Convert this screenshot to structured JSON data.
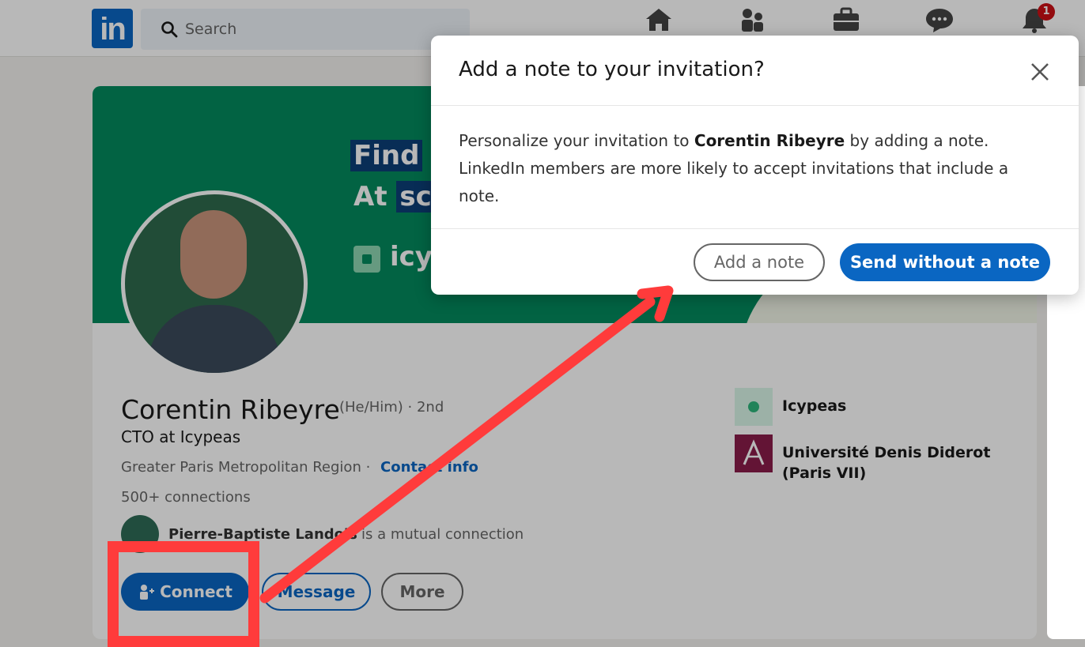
{
  "nav": {
    "logo": "in",
    "search_placeholder": "Search",
    "notifications_count": "1",
    "icons": [
      "home-icon",
      "my-network-icon",
      "jobs-icon",
      "messaging-icon",
      "notifications-icon"
    ]
  },
  "profile": {
    "banner_line1_a": "Find",
    "banner_line2_a": "At",
    "banner_line2_b": "sc",
    "banner_brand": "icy",
    "name": "Corentin Ribeyre",
    "pronouns": "(He/Him) · 2nd",
    "headline": "CTO at Icypeas",
    "location": "Greater Paris Metropolitan Region ·",
    "contact_info": "Contact info",
    "connections": "500+ connections",
    "mutual_name": "Pierre-Baptiste Landois",
    "mutual_rest": "is a mutual connection",
    "buttons": {
      "connect": "Connect",
      "message": "Message",
      "more": "More"
    },
    "orgs": [
      {
        "name": "Icypeas",
        "color": "#2db67c"
      },
      {
        "name": "Université Denis Diderot (Paris VII)",
        "color": "#8a1c4a"
      }
    ]
  },
  "modal": {
    "title": "Add a note to your invitation?",
    "body_pre": "Personalize your invitation to ",
    "body_name": "Corentin Ribeyre",
    "body_post": " by adding a note. LinkedIn members are more likely to accept invitations that include a note.",
    "add_note": "Add a note",
    "send_without": "Send without a note"
  },
  "colors": {
    "linkedin_blue": "#0a66c2",
    "banner_green": "#038a5d",
    "annotation_red": "#ff3b3b"
  }
}
